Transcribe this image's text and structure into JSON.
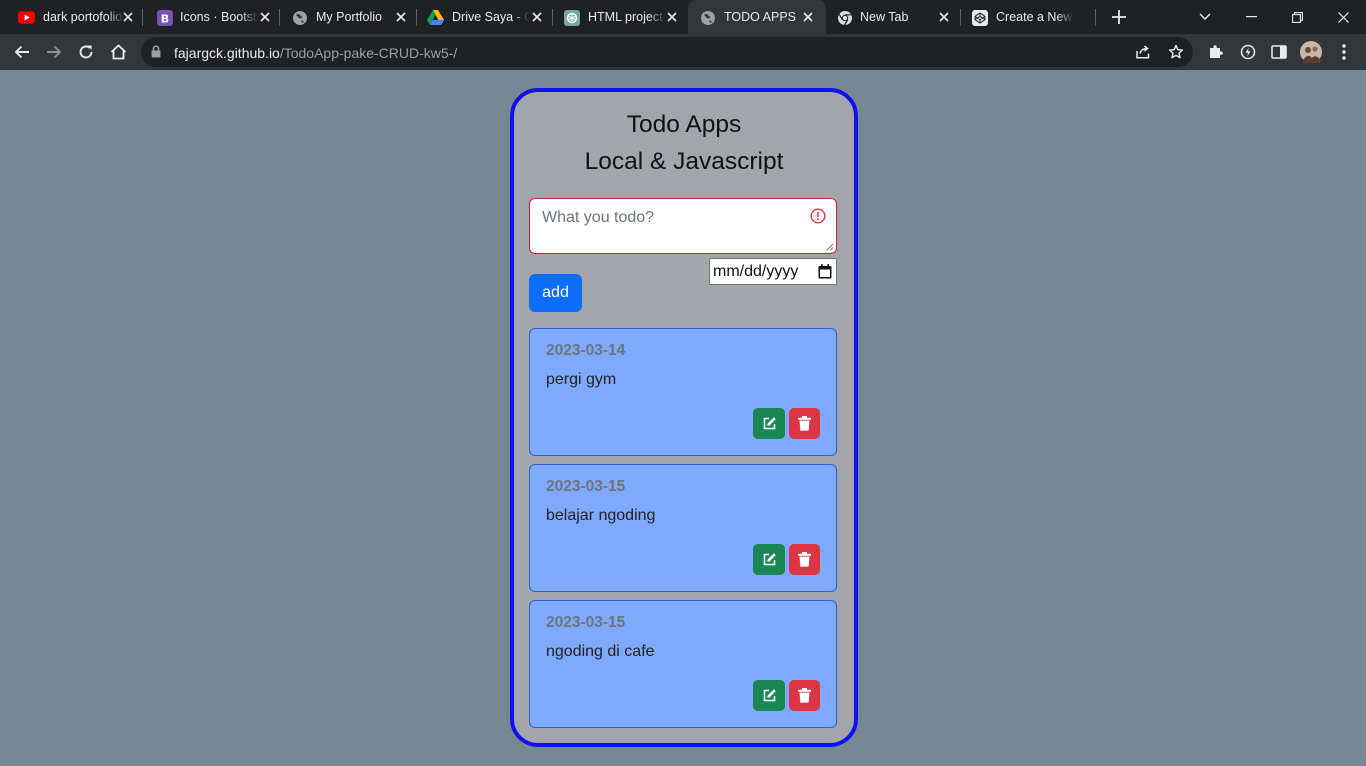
{
  "browser": {
    "tabs": [
      {
        "title": "dark portofolio",
        "icon": "youtube-icon"
      },
      {
        "title": "Icons · Bootstrap",
        "icon": "bootstrap-icon"
      },
      {
        "title": "My Portfolio",
        "icon": "globe-icon"
      },
      {
        "title": "Drive Saya - Google Drive",
        "icon": "google-drive-icon"
      },
      {
        "title": "HTML project",
        "icon": "chatgpt-icon"
      },
      {
        "title": "TODO APPS",
        "icon": "globe-icon",
        "active": true
      },
      {
        "title": "New Tab",
        "icon": "chrome-icon"
      },
      {
        "title": "Create a New",
        "icon": "codepen-icon"
      }
    ],
    "url_host": "fajargck.github.io",
    "url_path": "/TodoApp-pake-CRUD-kw5-/"
  },
  "app": {
    "title_line1": "Todo Apps",
    "title_line2": "Local & Javascript",
    "input_placeholder": "What you todo?",
    "date_placeholder": "mm/dd/yyyy",
    "add_label": "add"
  },
  "todos": [
    {
      "date": "2023-03-14",
      "text": "pergi gym"
    },
    {
      "date": "2023-03-15",
      "text": "belajar ngoding"
    },
    {
      "date": "2023-03-15",
      "text": "ngoding di cafe"
    }
  ],
  "colors": {
    "page_bg": "#778895",
    "card_bg": "#a2a5a9",
    "card_border": "#1010f0",
    "item_bg": "#7fa9fd",
    "add_button": "#0d6efd",
    "edit_button": "#198754",
    "delete_button": "#dc3545",
    "invalid_border": "#c8233b"
  }
}
